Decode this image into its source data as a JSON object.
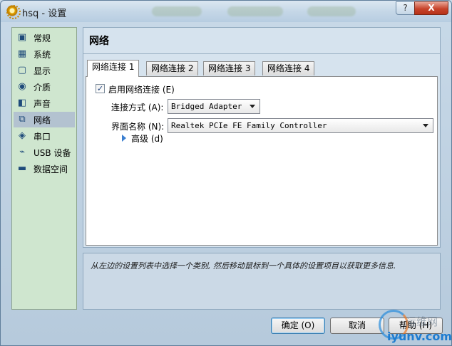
{
  "window": {
    "title": "hsq - 设置",
    "help_label": "?",
    "close_label": "X"
  },
  "sidebar": {
    "items": [
      {
        "label": "常规",
        "icon": "monitor-icon"
      },
      {
        "label": "系统",
        "icon": "chip-icon"
      },
      {
        "label": "显示",
        "icon": "display-icon"
      },
      {
        "label": "介质",
        "icon": "disc-icon"
      },
      {
        "label": "声音",
        "icon": "speaker-icon"
      },
      {
        "label": "网络",
        "icon": "network-icon"
      },
      {
        "label": "串口",
        "icon": "serial-port-icon"
      },
      {
        "label": "USB 设备",
        "icon": "usb-icon"
      },
      {
        "label": "数据空间",
        "icon": "folder-icon"
      }
    ],
    "selected": "网络"
  },
  "main": {
    "title": "网络",
    "tabs": [
      {
        "label": "网络连接 1"
      },
      {
        "label": "网络连接 2"
      },
      {
        "label": "网络连接 3"
      },
      {
        "label": "网络连接 4"
      }
    ],
    "enable_label": "启用网络连接 (E)",
    "enable_checked": true,
    "attached_label": "连接方式 (A):",
    "attached_value": "Bridged Adapter",
    "name_label": "界面名称 (N):",
    "name_value": "Realtek PCIe FE Family Controller",
    "advanced_label": "高级 (d)"
  },
  "info": {
    "text": "从左边的设置列表中选择一个类别, 然后移动鼠标到一个具体的设置项目以获取更多信息."
  },
  "buttons": {
    "ok": "确定 (O)",
    "cancel": "取消",
    "help": "帮助 (H)"
  },
  "watermark": {
    "top": "运维网",
    "bottom": "iyunv.com"
  },
  "colors": {
    "sidebar_bg": "#cfe6cf",
    "selected_bg": "#b3c2d0",
    "panel_bg": "#d6e3ee",
    "close_red": "#c7442b"
  }
}
